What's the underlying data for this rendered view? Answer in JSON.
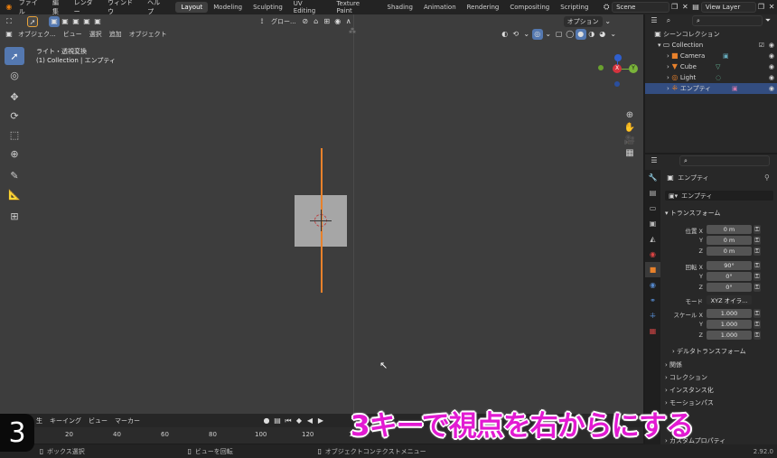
{
  "topbar": {
    "menus": [
      "ファイル",
      "編集",
      "レンダー",
      "ウィンドウ",
      "ヘルプ"
    ],
    "workspaces": [
      "Layout",
      "Modeling",
      "Sculpting",
      "UV Editing",
      "Texture Paint",
      "Shading",
      "Animation",
      "Rendering",
      "Compositing",
      "Scripting"
    ],
    "scene": "Scene",
    "view_layer": "View Layer"
  },
  "viewport": {
    "mode": "オブジェク...",
    "menus": [
      "ビュー",
      "選択",
      "追加",
      "オブジェクト"
    ],
    "orientation": "グロー...",
    "options": "オプション",
    "overlay_line1": "ライト・透視変換",
    "overlay_line2": "(1) Collection | エンプティ",
    "gizmo_labels": {
      "x": "X",
      "y": "Y",
      "z": "Z"
    }
  },
  "timeline": {
    "menus": [
      "生",
      "キーイング",
      "ビュー",
      "マーカー"
    ],
    "ticks": [
      "20",
      "40",
      "60",
      "80",
      "100",
      "120",
      "140"
    ]
  },
  "statusbar": {
    "left": "ボックス選択",
    "middle": "ビューを回転",
    "right": "オブジェクトコンテクストメニュー",
    "version": "2.92.0"
  },
  "outliner": {
    "root": "シーンコレクション",
    "collection": "Collection",
    "items": [
      {
        "label": "Camera",
        "icon": "camera-icon"
      },
      {
        "label": "Cube",
        "icon": "mesh-icon"
      },
      {
        "label": "Light",
        "icon": "light-icon"
      },
      {
        "label": "エンプティ",
        "icon": "empty-icon"
      }
    ]
  },
  "properties": {
    "object_name": "エンプティ",
    "data_name": "エンプティ",
    "transform_header": "トランスフォーム",
    "location_label": "位置 X",
    "rotation_label": "回転 X",
    "scale_label": "スケール X",
    "axis_y": "Y",
    "axis_z": "Z",
    "location": [
      "0 m",
      "0 m",
      "0 m"
    ],
    "rotation": [
      "90°",
      "0°",
      "0°"
    ],
    "mode_label": "モード",
    "mode_value": "XYZ オイラ...",
    "scale": [
      "1.000",
      "1.000",
      "1.000"
    ],
    "delta": "デルタトランスフォーム",
    "sections": [
      "関係",
      "コレクション",
      "インスタンス化",
      "モーションパス",
      "カスタムプロパティ"
    ]
  },
  "caption": "3キーで視点を右からにする",
  "badge": "3",
  "colors": {
    "accent": "#e21ad2",
    "select": "#5478b0",
    "empty_axis": "#e8812b"
  }
}
